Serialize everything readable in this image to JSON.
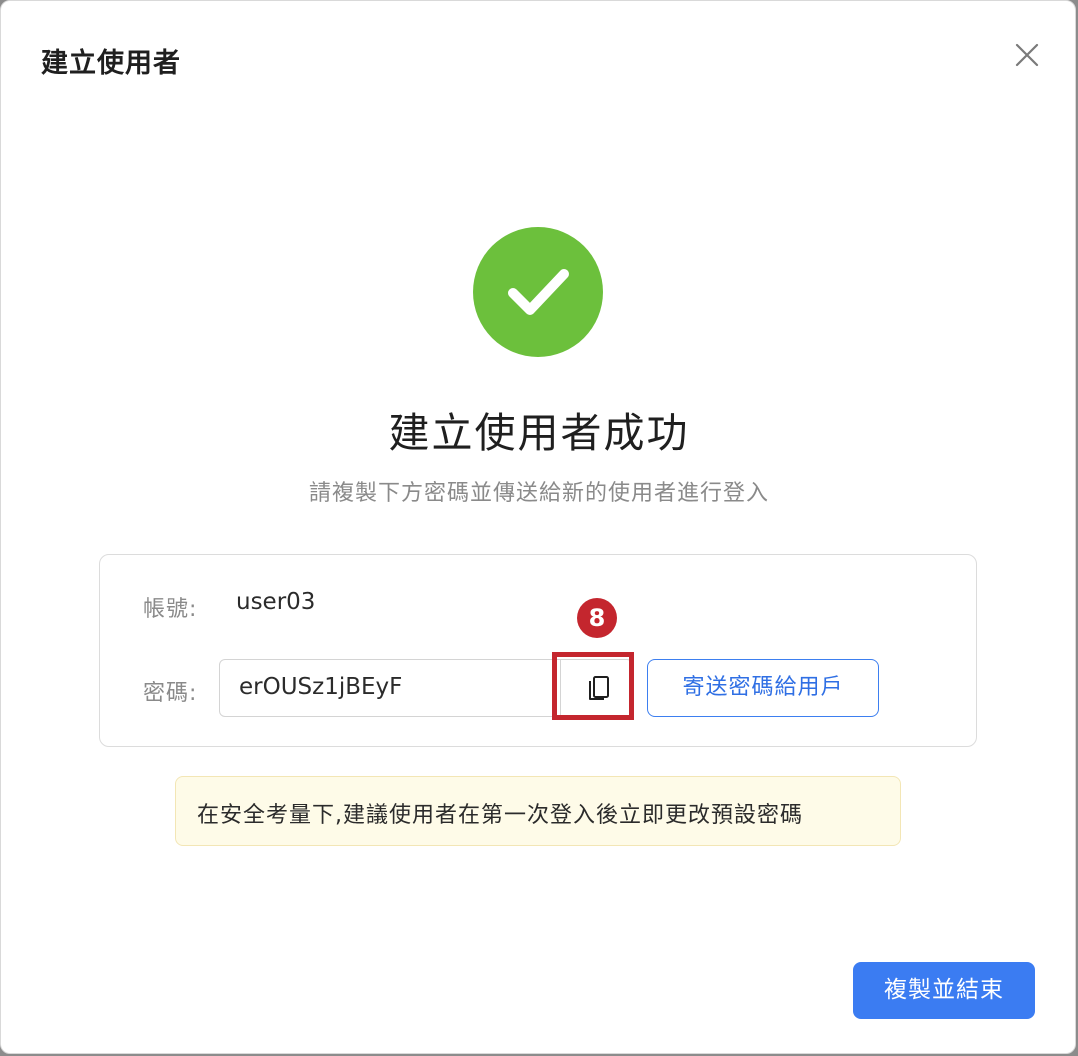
{
  "modal": {
    "title": "建立使用者",
    "close_icon": "close-icon"
  },
  "success": {
    "icon": "check-circle-icon",
    "color": "#6cc03c",
    "title": "建立使用者成功",
    "subtitle": "請複製下方密碼並傳送給新的使用者進行登入"
  },
  "credentials": {
    "account_label": "帳號:",
    "account_value": "user03",
    "password_label": "密碼:",
    "password_value": "erOUSz1jBEyF",
    "copy_icon": "copy-icon",
    "send_button_label": "寄送密碼給用戶"
  },
  "annotation": {
    "step_number": "8",
    "color": "#c4262e"
  },
  "warning": {
    "text": "在安全考量下,建議使用者在第一次登入後立即更改預設密碼"
  },
  "footer": {
    "finish_button_label": "複製並結束",
    "accent_color": "#3b7cf2"
  }
}
